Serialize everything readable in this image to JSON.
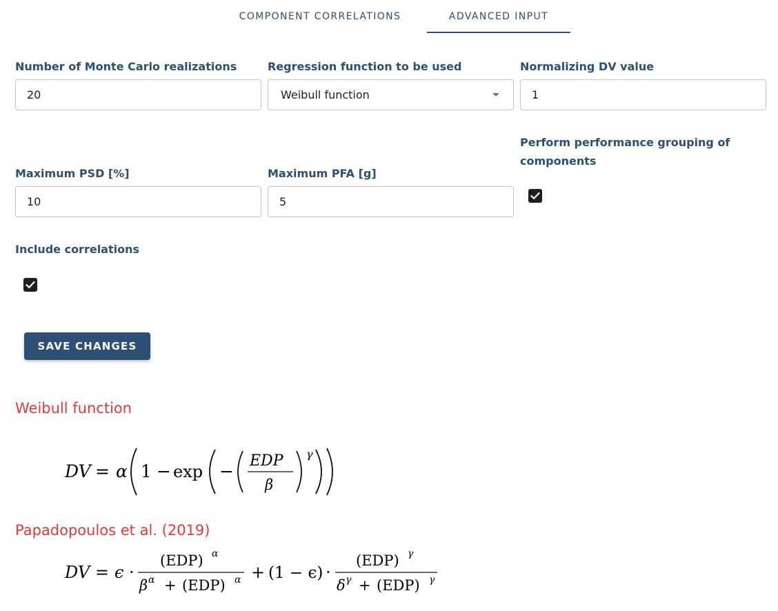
{
  "tabs": [
    {
      "label": "COMPONENT CORRELATIONS",
      "active": false
    },
    {
      "label": "ADVANCED INPUT",
      "active": true
    }
  ],
  "form": {
    "monte_carlo": {
      "label": "Number of Monte Carlo realizations",
      "value": "20"
    },
    "regression": {
      "label": "Regression function to be used",
      "value": "Weibull function"
    },
    "normalizing_dv": {
      "label": "Normalizing DV value",
      "value": "1"
    },
    "max_psd": {
      "label": "Maximum PSD [%]",
      "value": "10"
    },
    "max_pfa": {
      "label": "Maximum PFA [g]",
      "value": "5"
    },
    "performance_grouping": {
      "label": "Perform performance grouping of components",
      "checked": true
    },
    "include_correlations": {
      "label": "Include correlations",
      "checked": true
    }
  },
  "save_button": "SAVE CHANGES",
  "weibull": {
    "title": "Weibull function",
    "eq": {
      "lhs": "DV",
      "eq": "=",
      "alpha": "α",
      "one": "1",
      "minus": "−",
      "exp": "exp",
      "num": "EDP",
      "den": "β",
      "pow": "γ"
    }
  },
  "papadopoulos": {
    "title": "Papadopoulos et al. (2019)",
    "eq": {
      "lhs": "DV",
      "eq": "=",
      "epsilon": "ϵ",
      "dot": "·",
      "num1": "(EDP)",
      "num1_pow": "α",
      "den1_a": "β",
      "den1_a_pow": "α",
      "plus": "+",
      "den1_b": "(EDP)",
      "den1_b_pow": "α",
      "mid": "(1 − ϵ)",
      "num2": "(EDP)",
      "num2_pow": "γ",
      "den2_a": "δ",
      "den2_a_pow": "γ",
      "den2_b": "(EDP)",
      "den2_b_pow": "γ"
    }
  },
  "colors": {
    "primary": "#2d4f73",
    "accent_red": "#e53935"
  }
}
